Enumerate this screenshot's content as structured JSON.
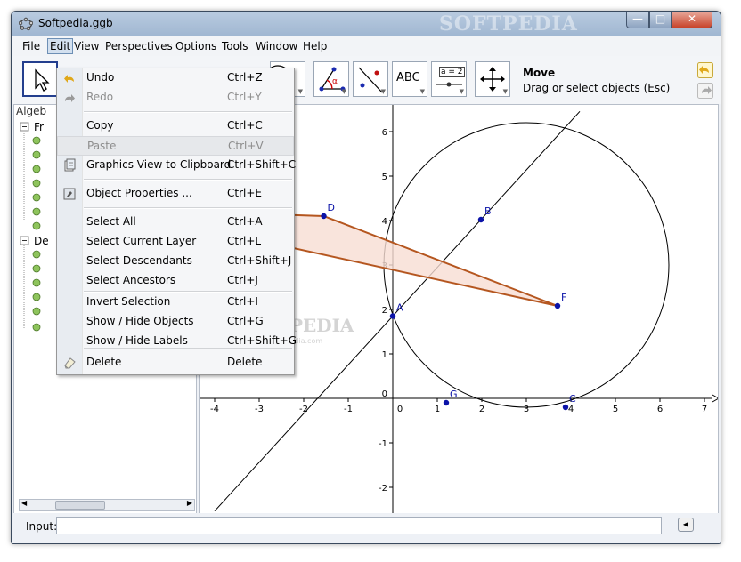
{
  "window": {
    "title": "Softpedia.ggb",
    "watermark": "SOFTPEDIA",
    "buttons": {
      "minimize": "—",
      "maximize": "□",
      "close": "✕"
    }
  },
  "menubar": [
    "File",
    "Edit",
    "View",
    "Perspectives",
    "Options",
    "Tools",
    "Window",
    "Help"
  ],
  "toolbar": {
    "active_tool_label": "Move",
    "active_tool_help": "Drag or select objects (Esc)",
    "text_tool": "ABC",
    "slider_tool": "a = 2"
  },
  "algebra": {
    "title": "Algeb",
    "groups": [
      "Fr",
      "De"
    ]
  },
  "edit_menu": {
    "items": [
      {
        "label": "Undo",
        "shortcut": "Ctrl+Z",
        "icon": "undo-icon",
        "disabled": false
      },
      {
        "label": "Redo",
        "shortcut": "Ctrl+Y",
        "icon": "redo-icon",
        "disabled": true
      },
      {
        "label": "Copy",
        "shortcut": "Ctrl+C",
        "icon": "",
        "disabled": false
      },
      {
        "label": "Paste",
        "shortcut": "Ctrl+V",
        "icon": "",
        "disabled": true
      },
      {
        "label": "Graphics View to Clipboard",
        "shortcut": "Ctrl+Shift+C",
        "icon": "clipboard-icon",
        "disabled": false
      },
      {
        "label": "Object Properties ...",
        "shortcut": "Ctrl+E",
        "icon": "properties-icon",
        "disabled": false
      },
      {
        "label": "Select All",
        "shortcut": "Ctrl+A",
        "icon": "",
        "disabled": false
      },
      {
        "label": "Select Current Layer",
        "shortcut": "Ctrl+L",
        "icon": "",
        "disabled": false
      },
      {
        "label": "Select Descendants",
        "shortcut": "Ctrl+Shift+J",
        "icon": "",
        "disabled": false
      },
      {
        "label": "Select Ancestors",
        "shortcut": "Ctrl+J",
        "icon": "",
        "disabled": false
      },
      {
        "label": "Invert Selection",
        "shortcut": "Ctrl+I",
        "icon": "",
        "disabled": false
      },
      {
        "label": "Show / Hide Objects",
        "shortcut": "Ctrl+G",
        "icon": "",
        "disabled": false
      },
      {
        "label": "Show / Hide Labels",
        "shortcut": "Ctrl+Shift+G",
        "icon": "",
        "disabled": false
      },
      {
        "label": "Delete",
        "shortcut": "Delete",
        "icon": "eraser-icon",
        "disabled": false
      }
    ]
  },
  "graphics": {
    "x_ticks": [
      "-4",
      "-3",
      "-2",
      "-1",
      "0",
      "1",
      "2",
      "3",
      "4",
      "5",
      "6",
      "7"
    ],
    "y_ticks": [
      "6",
      "5",
      "4",
      "3",
      "2",
      "1",
      "0",
      "-1",
      "-2"
    ],
    "points": [
      {
        "label": "A",
        "x": 0,
        "y": 1.85
      },
      {
        "label": "B",
        "x": 1.98,
        "y": 4.02
      },
      {
        "label": "C",
        "x": 3.88,
        "y": -0.2
      },
      {
        "label": "D",
        "x": -1.55,
        "y": 4.1
      },
      {
        "label": "F",
        "x": 3.7,
        "y": 2.08
      },
      {
        "label": "G",
        "x": 1.2,
        "y": -0.1
      }
    ],
    "watermark": "SOFTPEDIA",
    "watermark_url": "www.softpedia.com",
    "colors": {
      "point": "#0b13a8",
      "polygon_stroke": "#b5561f",
      "polygon_fill": "#f7ddd3"
    }
  },
  "input": {
    "label": "Input:",
    "value": ""
  }
}
